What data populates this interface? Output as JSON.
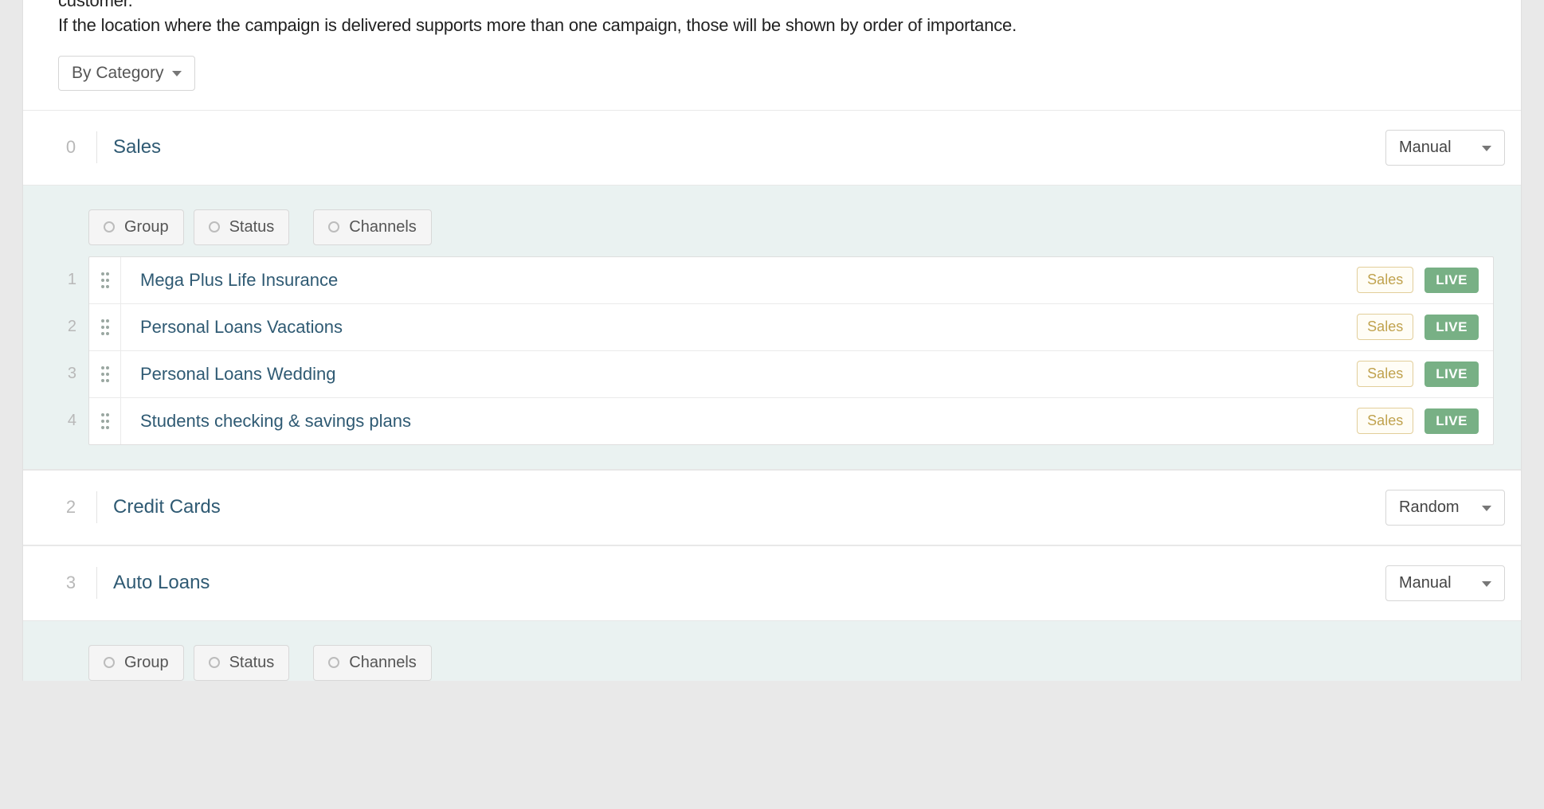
{
  "intro": {
    "cut_word": "customer.",
    "line": "If the location where the campaign is delivered supports more than one campaign, those will be shown by order of importance.",
    "view_dropdown_label": "By Category"
  },
  "filters": {
    "group": "Group",
    "status": "Status",
    "channels": "Channels"
  },
  "categories": [
    {
      "index": "0",
      "title": "Sales",
      "sort": "Manual",
      "show_body": true,
      "campaigns": [
        {
          "n": "1",
          "name": "Mega Plus Life Insurance",
          "tag": "Sales",
          "status": "LIVE"
        },
        {
          "n": "2",
          "name": "Personal Loans Vacations",
          "tag": "Sales",
          "status": "LIVE"
        },
        {
          "n": "3",
          "name": "Personal Loans Wedding",
          "tag": "Sales",
          "status": "LIVE"
        },
        {
          "n": "4",
          "name": "Students checking & savings plans",
          "tag": "Sales",
          "status": "LIVE"
        }
      ]
    },
    {
      "index": "2",
      "title": "Credit Cards",
      "sort": "Random",
      "show_body": false,
      "campaigns": []
    },
    {
      "index": "3",
      "title": "Auto Loans",
      "sort": "Manual",
      "show_body": true,
      "body_cut": true,
      "campaigns": []
    }
  ]
}
